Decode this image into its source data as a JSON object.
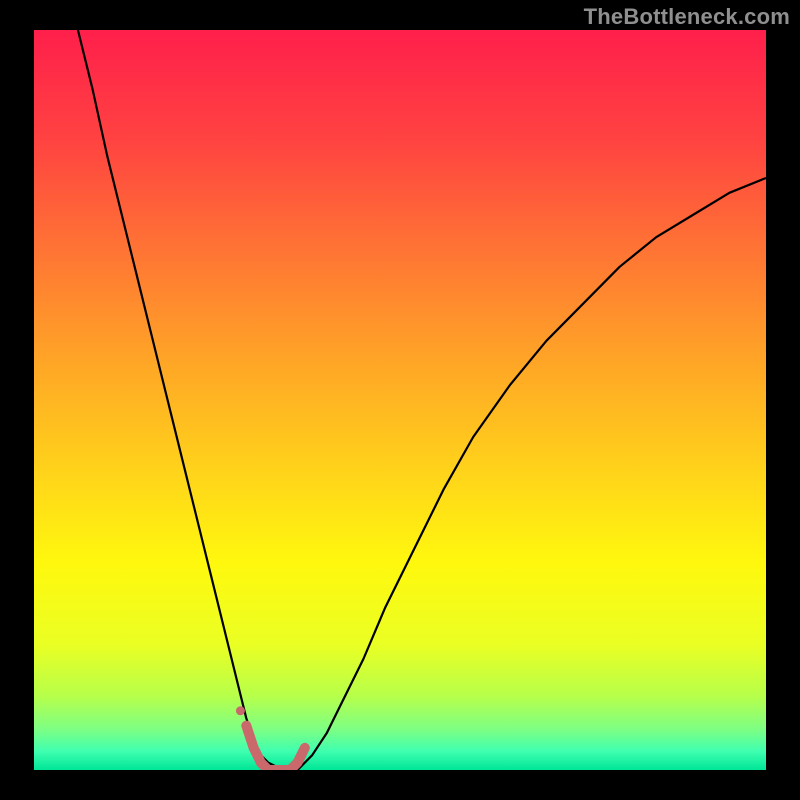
{
  "watermark": "TheBottleneck.com",
  "chart_data": {
    "type": "line",
    "title": "",
    "xlabel": "",
    "ylabel": "",
    "xlim": [
      0,
      100
    ],
    "ylim": [
      0,
      100
    ],
    "grid": false,
    "legend": false,
    "background": {
      "type": "vertical-gradient",
      "stops": [
        {
          "pos": 0.0,
          "color": "#ff1f4b"
        },
        {
          "pos": 0.15,
          "color": "#ff4341"
        },
        {
          "pos": 0.3,
          "color": "#ff7534"
        },
        {
          "pos": 0.45,
          "color": "#ffa626"
        },
        {
          "pos": 0.6,
          "color": "#ffd41a"
        },
        {
          "pos": 0.72,
          "color": "#fff80e"
        },
        {
          "pos": 0.83,
          "color": "#eaff23"
        },
        {
          "pos": 0.9,
          "color": "#b7ff4a"
        },
        {
          "pos": 0.945,
          "color": "#7dff84"
        },
        {
          "pos": 0.975,
          "color": "#3effb0"
        },
        {
          "pos": 1.0,
          "color": "#00e597"
        }
      ]
    },
    "series": [
      {
        "name": "bottleneck-curve",
        "color": "#000000",
        "width": 2.2,
        "x": [
          6,
          8,
          10,
          12,
          14,
          16,
          18,
          20,
          22,
          24,
          26,
          27,
          28,
          29,
          30,
          31,
          32,
          34,
          36,
          37,
          38,
          40,
          42,
          45,
          48,
          52,
          56,
          60,
          65,
          70,
          75,
          80,
          85,
          90,
          95,
          100
        ],
        "y": [
          100,
          92,
          83,
          75,
          67,
          59,
          51,
          43,
          35,
          27,
          19,
          15,
          11,
          7,
          4,
          2,
          1,
          0,
          0,
          1,
          2,
          5,
          9,
          15,
          22,
          30,
          38,
          45,
          52,
          58,
          63,
          68,
          72,
          75,
          78,
          80
        ]
      },
      {
        "name": "min-flat-highlight",
        "color": "#c9696c",
        "width": 10,
        "cap": "round",
        "x": [
          29,
          30,
          31,
          32,
          33,
          34,
          35,
          36,
          37
        ],
        "y": [
          6,
          3,
          1,
          0,
          0,
          0,
          0,
          1,
          3
        ]
      }
    ],
    "annotations": [
      {
        "name": "highlight-dot",
        "x": 28.2,
        "y": 8,
        "r": 4.5,
        "color": "#c9696c"
      }
    ]
  }
}
